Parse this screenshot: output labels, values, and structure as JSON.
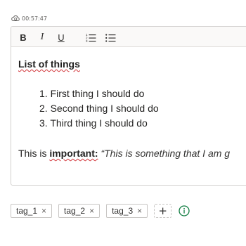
{
  "timestamp": "00:57:47",
  "toolbar": {
    "bold": "B",
    "italic": "I",
    "underline": "U"
  },
  "editor": {
    "heading": "List of things",
    "list_items": [
      "1. First thing I should do",
      "2. Second thing I should do",
      "3. Third thing I should do"
    ],
    "paragraph": {
      "prefix": "This is ",
      "important": "important:",
      "quote": " “This is something that I am g"
    }
  },
  "tags": [
    "tag_1",
    "tag_2",
    "tag_3"
  ],
  "tag_remove_glyph": "×",
  "add_tag_glyph": "+",
  "colors": {
    "accent_green": "#107c41",
    "spell_error": "#d13438"
  }
}
